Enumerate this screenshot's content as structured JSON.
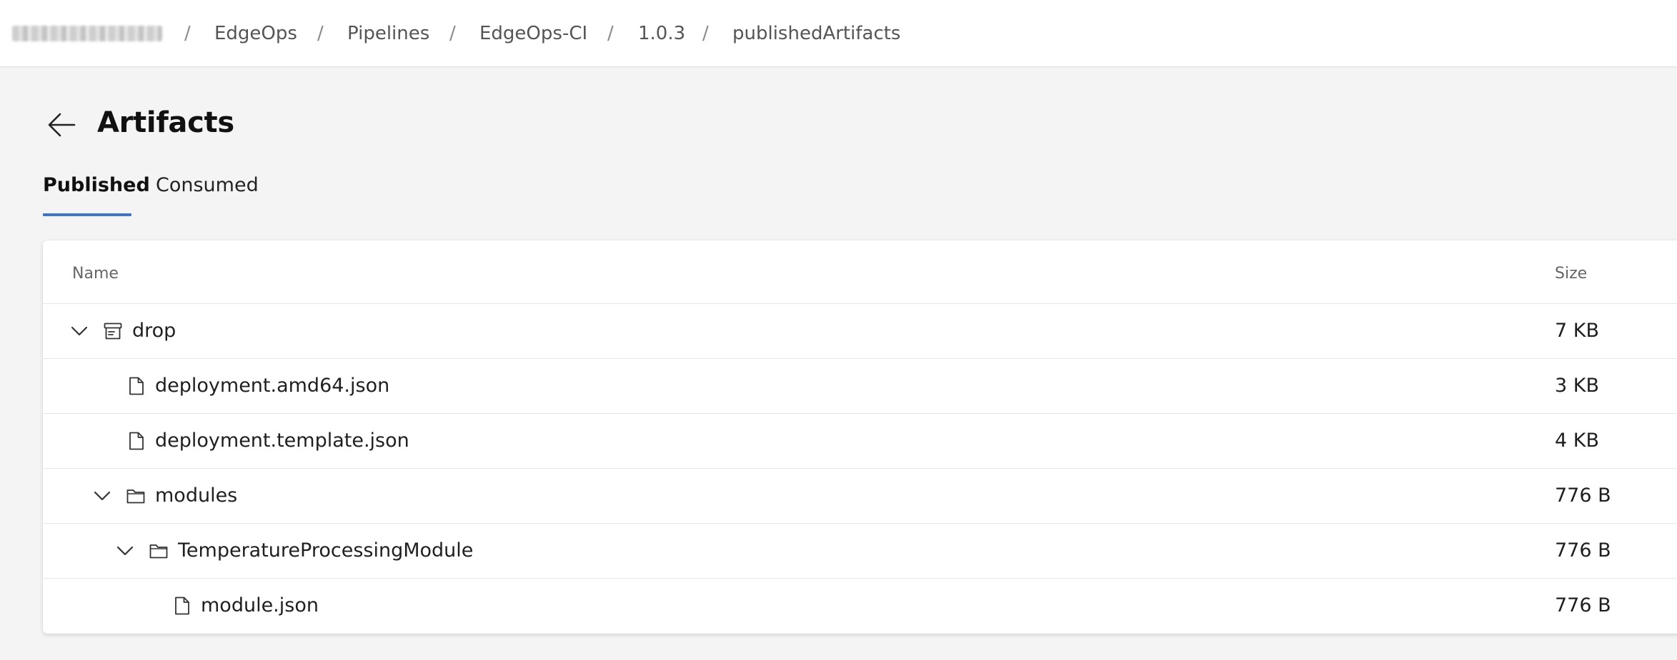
{
  "breadcrumb": {
    "items": [
      "EdgeOps",
      "Pipelines",
      "EdgeOps-CI",
      "1.0.3",
      "publishedArtifacts"
    ],
    "separator": "/"
  },
  "header": {
    "title": "Artifacts"
  },
  "tabs": [
    {
      "label": "Published",
      "active": true
    },
    {
      "label": "Consumed",
      "active": false
    }
  ],
  "table": {
    "columns": {
      "name": "Name",
      "size": "Size"
    },
    "rows": [
      {
        "name": "drop",
        "size": "7 KB",
        "kind": "artifact",
        "expanded": true,
        "depth": 0
      },
      {
        "name": "deployment.amd64.json",
        "size": "3 KB",
        "kind": "file",
        "depth": 1
      },
      {
        "name": "deployment.template.json",
        "size": "4 KB",
        "kind": "file",
        "depth": 1
      },
      {
        "name": "modules",
        "size": "776 B",
        "kind": "folder",
        "expanded": true,
        "depth": 1
      },
      {
        "name": "TemperatureProcessingModule",
        "size": "776 B",
        "kind": "folder",
        "expanded": true,
        "depth": 2
      },
      {
        "name": "module.json",
        "size": "776 B",
        "kind": "file",
        "depth": 3
      }
    ]
  },
  "colors": {
    "accent": "#3f74c8",
    "background": "#f4f4f4",
    "card": "#ffffff"
  },
  "icons": {
    "back": "arrow-left-icon",
    "artifact": "artifact-box-icon",
    "folder": "folder-icon",
    "file": "file-icon",
    "expand": "chevron-down-icon"
  }
}
